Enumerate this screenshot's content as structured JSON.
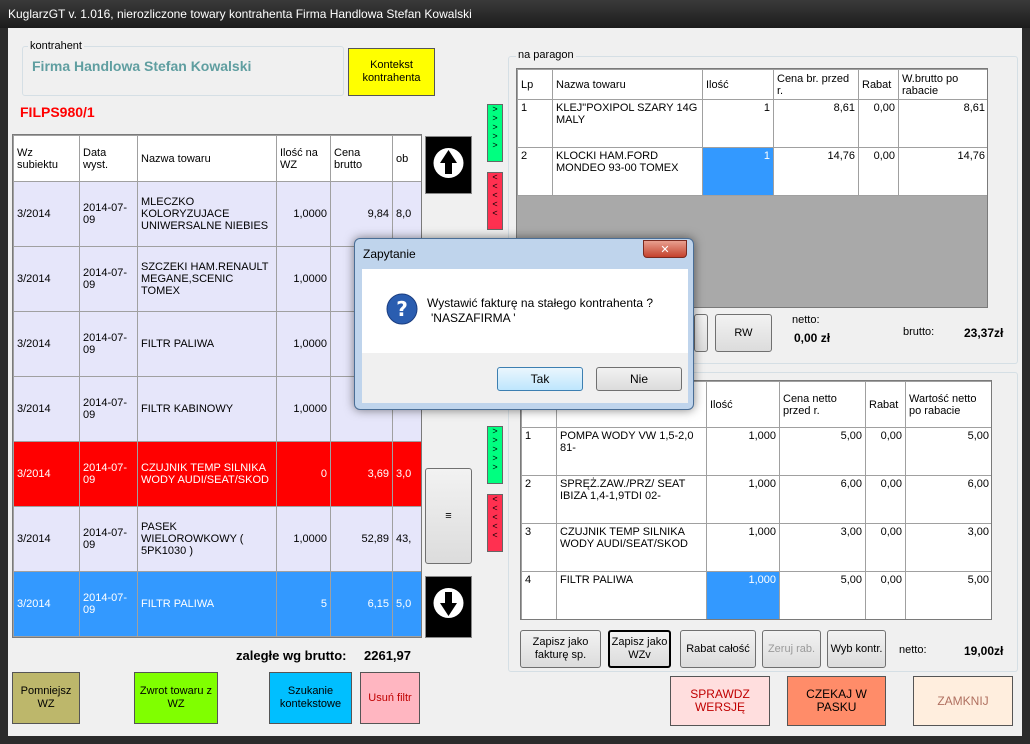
{
  "window": {
    "title": "KuglarzGT v. 1.016, nierozliczone towary kontrahenta Firma Handlowa Stefan Kowalski"
  },
  "contractor": {
    "label": "kontrahent",
    "name": "Firma Handlowa Stefan Kowalski",
    "context_button": "Kontekst kontrahenta"
  },
  "doc_number": "FILPS980/1",
  "left_table": {
    "headers": [
      "Wz subiektu",
      "Data wyst.",
      "Nazwa towaru",
      "Ilość na WZ",
      "Cena brutto",
      "ob"
    ],
    "rows": [
      [
        "3/2014",
        "2014-07-09",
        "MLECZKO KOLORYZUJACE UNIWERSALNE NIEBIES",
        "1,0000",
        "9,84",
        "8,0"
      ],
      [
        "3/2014",
        "2014-07-09",
        "SZCZEKI HAM.RENAULT MEGANE,SCENIC TOMEX",
        "1,0000",
        "",
        ""
      ],
      [
        "3/2014",
        "2014-07-09",
        "FILTR PALIWA",
        "1,0000",
        "",
        ""
      ],
      [
        "3/2014",
        "2014-07-09",
        "FILTR KABINOWY",
        "1,0000",
        "",
        ""
      ],
      [
        "3/2014",
        "2014-07-09",
        "CZUJNIK TEMP SILNIKA WODY AUDI/SEAT/SKOD",
        "0",
        "3,69",
        "3,0"
      ],
      [
        "3/2014",
        "2014-07-09",
        "PASEK WIELOROWKOWY ( 5PK1030 )",
        "1,0000",
        "52,89",
        "43,"
      ],
      [
        "3/2014",
        "2014-07-09",
        "FILTR PALIWA",
        "5",
        "6,15",
        "5,0"
      ]
    ]
  },
  "arrears": {
    "label": "zaległe wg brutto:",
    "value": "2261,97"
  },
  "left_buttons": {
    "pomniejsz": "Pomniejsz WZ",
    "zwrot": "Zwrot towaru z WZ",
    "szukanie": "Szukanie kontekstowe",
    "usun": "Usuń filtr"
  },
  "receipt": {
    "label": "na paragon",
    "headers": [
      "Lp",
      "Nazwa towaru",
      "Ilość",
      "Cena br. przed r.",
      "Rabat",
      "W.brutto po rabacie"
    ],
    "rows": [
      [
        "1",
        "KLEJ\"POXIPOL SZARY 14G MALY",
        "1",
        "8,61",
        "0,00",
        "8,61"
      ],
      [
        "2",
        "KLOCKI HAM.FORD MONDEO 93-00      TOMEX",
        "1",
        "14,76",
        "0,00",
        "14,76"
      ]
    ],
    "rw_button": "RW",
    "netto_label": "netto:",
    "netto_value": "0,00 zł",
    "brutto_label": "brutto:",
    "brutto_value": "23,37zł"
  },
  "invoice": {
    "headers": [
      "",
      "",
      "Ilość",
      "Cena netto przed r.",
      "Rabat",
      "Wartość netto po rabacie"
    ],
    "rows": [
      [
        "1",
        "POMPA WODY VW 1,5-2,0 81-",
        "1,000",
        "5,00",
        "0,00",
        "5,00"
      ],
      [
        "2",
        "SPRĘŻ.ZAW./PRZ/ SEAT IBIZA 1,4-1,9TDI 02-",
        "1,000",
        "6,00",
        "0,00",
        "6,00"
      ],
      [
        "3",
        "CZUJNIK TEMP SILNIKA WODY AUDI/SEAT/SKOD",
        "1,000",
        "3,00",
        "0,00",
        "3,00"
      ],
      [
        "4",
        "FILTR PALIWA",
        "1,000",
        "5,00",
        "0,00",
        "5,00"
      ]
    ],
    "buttons": {
      "faktura_sp": "Zapisz jako fakturę sp.",
      "wzv": "Zapisz jako WZv",
      "rabat": "Rabat całość",
      "zeruj": "Zeruj rab.",
      "wyb": "Wyb kontr."
    },
    "netto_label": "netto:",
    "netto_value": "19,00zł"
  },
  "bottom_buttons": {
    "sprawdz": "SPRAWDZ WERSJĘ",
    "czekaj": "CZEKAJ W PASKU",
    "zamknij": "ZAMKNIJ"
  },
  "dialog": {
    "title": "Zapytanie",
    "message": "Wystawić fakturę na stałego kontrahenta ?",
    "message2": "'NASZAFIRMA '",
    "yes": "Tak",
    "no": "Nie"
  },
  "colors": {
    "yellow": "#ffff00",
    "red": "#ff0000",
    "blue": "#3399ff",
    "green": "#80ff00",
    "cyan": "#00bfff",
    "olive": "#bdb76b",
    "salmon": "#ffa07a",
    "pink": "#ffb6c1"
  }
}
